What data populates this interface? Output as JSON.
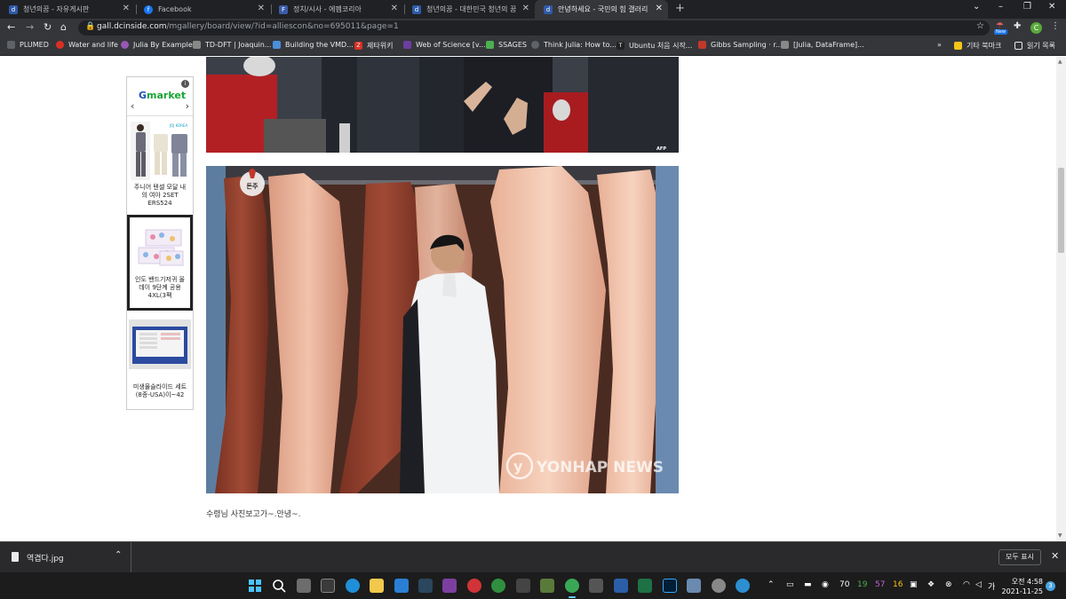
{
  "tabs": [
    {
      "title": "청년의꿈 - 자유게시판",
      "icon": "dcinside-icon",
      "active": false
    },
    {
      "title": "Facebook",
      "icon": "facebook-icon",
      "active": false
    },
    {
      "title": "정치/시사 - 에펨코리아",
      "icon": "fmkorea-icon",
      "active": false
    },
    {
      "title": "청년의꿈 - 대한민국 청년의 꿈",
      "icon": "dcinside-icon",
      "active": false
    },
    {
      "title": "안녕하세요 - 국민의 힘 갤러리",
      "icon": "dcinside-icon",
      "active": true
    }
  ],
  "address_bar": {
    "domain": "gall.dcinside.com",
    "path": "/mgallery/board/view/?id=alliescon&no=695011&page=1"
  },
  "toolbar": {
    "new_badge": "New",
    "profile_initial": "C"
  },
  "bookmarks": [
    {
      "label": "PLUMED",
      "icon": "globe-icon",
      "color": "#e8eaed"
    },
    {
      "label": "Water and life",
      "icon": "water-icon",
      "color": "#d93025"
    },
    {
      "label": "Julia By Example",
      "icon": "julia-icon",
      "color": "#9558b2"
    },
    {
      "label": "TD-DFT | Joaquin...",
      "icon": "page-icon",
      "color": "#888888"
    },
    {
      "label": "Building the VMD...",
      "icon": "vmd-icon",
      "color": "#4a90d9"
    },
    {
      "label": "제타위키",
      "icon": "zetawiki-icon",
      "color": "#d93025"
    },
    {
      "label": "Web of Science [v...",
      "icon": "wos-icon",
      "color": "#6b3fa0"
    },
    {
      "label": "SSAGES",
      "icon": "ssages-icon",
      "color": "#4caf50"
    },
    {
      "label": "Think Julia: How to...",
      "icon": "globe-icon",
      "color": "#e8eaed"
    },
    {
      "label": "Ubuntu 처음 시작...",
      "icon": "tistory-icon",
      "color": "#222222"
    },
    {
      "label": "Gibbs Sampling · r...",
      "icon": "rpubs-icon",
      "color": "#c0392b"
    },
    {
      "label": "[Julia, DataFrame]...",
      "icon": "page-icon",
      "color": "#888888"
    }
  ],
  "bookmarks_overflow": "»",
  "other_bookmarks": "기타 북마크",
  "reading_list": "읽기 목록",
  "ad": {
    "brand_g": "G",
    "brand_rest": "market",
    "info": "i",
    "items": [
      {
        "label": "주니어 텐셀 모달 내의 여아 2SET ERS524",
        "selected": false
      },
      {
        "label": "인도 밴드기저귀 올데이 9단계 공용 4XL(3팩",
        "selected": true
      },
      {
        "label": "미생물슬라이드 세트(8종-USA)이~42",
        "selected": false
      }
    ],
    "item1_badge": "JOJ KOREA"
  },
  "photo1_credit": "AFP",
  "photo2_watermark": "YONHAP NEWS",
  "photo2_logo": "돈주",
  "caption": "수령님 사진보고가~.안녕~.",
  "download": {
    "filename": "역겹다.jpg",
    "show_all": "모두 표시"
  },
  "taskbar": {
    "tray_numbers": [
      {
        "value": "70",
        "color": "#ffffff"
      },
      {
        "value": "19",
        "color": "#4caf50"
      },
      {
        "value": "57",
        "color": "#c062d6"
      },
      {
        "value": "16",
        "color": "#f5c518"
      }
    ],
    "ime": "가",
    "clock_time": "오전 4:58",
    "clock_date": "2021-11-25",
    "notifications": "3"
  }
}
